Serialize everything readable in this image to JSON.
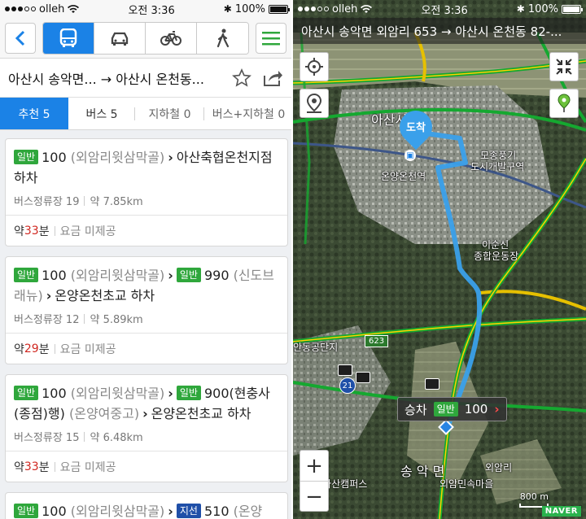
{
  "left": {
    "status": {
      "carrier": "olleh",
      "time": "오전 3:36",
      "battery": "100%"
    },
    "modes": [
      {
        "name": "bus",
        "icon": "bus-icon",
        "active": true
      },
      {
        "name": "car",
        "icon": "car-icon",
        "active": false
      },
      {
        "name": "bike",
        "icon": "bicycle-icon",
        "active": false
      },
      {
        "name": "walk",
        "icon": "walk-icon",
        "active": false
      }
    ],
    "route_title": "아산시 송악면... → 아산시 온천동...",
    "tabs": [
      {
        "label": "추천 5",
        "active": true
      },
      {
        "label": "버스 5",
        "active": false
      },
      {
        "label": "지하철 0",
        "active": false
      },
      {
        "label": "버스+지하철 0",
        "active": false
      }
    ],
    "cards": [
      {
        "title_parts": {
          "badge1": "일반",
          "bus1": "100",
          "via1": "(외암리윗삼막골)",
          "dest": "아산축협온천지점 하차"
        },
        "stops": "버스정류장 19",
        "distance": "약 7.85km",
        "time_prefix": "약 ",
        "time_num": "33",
        "time_unit": "분",
        "fee": "요금 미제공"
      },
      {
        "title_parts": {
          "badge1": "일반",
          "bus1": "100",
          "via1": "(외암리윗삼막골)",
          "badge2": "일반",
          "bus2": "990",
          "via2": "(신도브래뉴)",
          "dest": "온양온천초교 하차"
        },
        "stops": "버스정류장 12",
        "distance": "약 5.89km",
        "time_prefix": "약 ",
        "time_num": "29",
        "time_unit": "분",
        "fee": "요금 미제공"
      },
      {
        "title_parts": {
          "badge1": "일반",
          "bus1": "100",
          "via1": "(외암리윗삼막골)",
          "badge2": "일반",
          "bus2": "900(현충사(종점)행)",
          "via2": "(온양여중고)",
          "dest": "온양온천초교 하차"
        },
        "stops": "버스정류장 15",
        "distance": "약 6.48km",
        "time_prefix": "약 ",
        "time_num": "33",
        "time_unit": "분",
        "fee": "요금 미제공"
      },
      {
        "title_parts": {
          "badge1": "일반",
          "bus1": "100",
          "via1": "(외암리윗삼막골)",
          "badge2": "지선",
          "bus2": "510",
          "via2": "(온양"
        }
      }
    ]
  },
  "right": {
    "status": {
      "carrier": "olleh",
      "time": "오전 3:36",
      "battery": "100%"
    },
    "banner": "아산시 송악면 외암리 653 → 아산시 온천동 82-...",
    "labels": {
      "asan": "아산시",
      "station": "온양온천역",
      "district": "모종풍기",
      "district2": "도시개발구역",
      "stadium1": "이순신",
      "stadium2": "종합운동장",
      "road": "623",
      "dansi": "안동공단지",
      "songak": "송 악 면",
      "oeam": "외암리",
      "village": "외암민속마을",
      "campus": "남대아산캠퍼스",
      "route21": "21"
    },
    "dest_pin": "도착",
    "board": {
      "label": "승차",
      "badge": "일반",
      "bus": "100"
    },
    "scale": "800 m",
    "brand": "NAVER",
    "zoom_in": "+",
    "zoom_out": "−",
    "colors": {
      "accent": "#1b82e6",
      "route": "#3aa0ea",
      "badge_green": "#2fa73c",
      "time_red": "#d0261f"
    }
  }
}
